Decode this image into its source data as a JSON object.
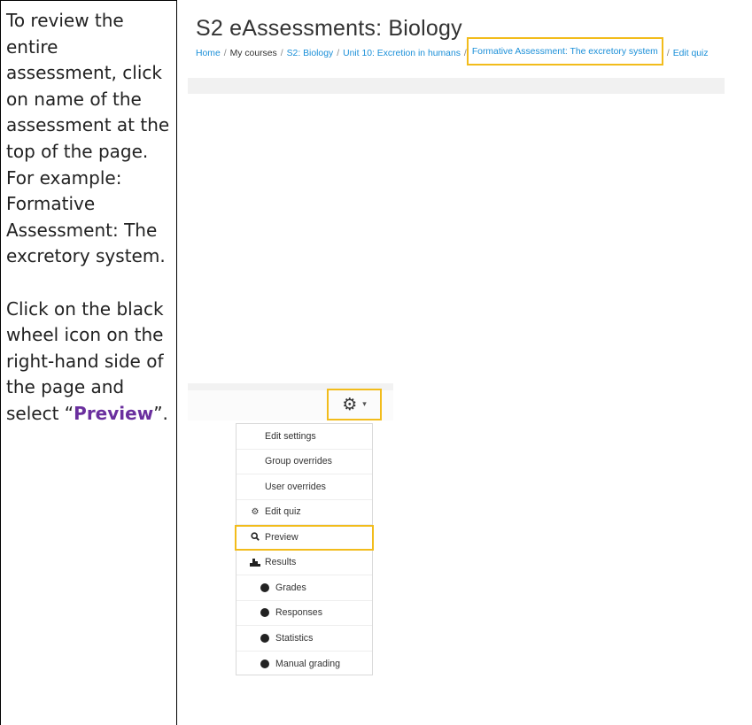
{
  "instructions": {
    "paragraph1": "To review the entire assessment, click on name of the assessment at the top of the page. For example: Formative Assessment: The excretory system.",
    "paragraph2_before": "Click on the black wheel icon on the right-hand side of the page and select “",
    "paragraph2_highlight": "Preview",
    "paragraph2_after": "”."
  },
  "screenshot1": {
    "page_title": "S2 eAssessments: Biology",
    "breadcrumb": [
      "Home",
      "My courses",
      "S2: Biology",
      "Unit 10: Excretion in humans",
      "Formative Assessment: The excretory system",
      "Edit quiz"
    ],
    "separator": "/"
  },
  "screenshot2": {
    "gear_icon": "⚙",
    "caret_icon": "▾",
    "menu_items": {
      "edit_settings": "Edit settings",
      "group_overrides": "Group overrides",
      "user_overrides": "User overrides",
      "edit_quiz": "Edit quiz",
      "preview": "Preview",
      "results": "Results",
      "grades": "Grades",
      "responses": "Responses",
      "statistics": "Statistics",
      "manual_grading": "Manual grading"
    }
  },
  "colors": {
    "highlight_border": "#f2bc1b",
    "link_blue": "#1a8fd8",
    "emphasis_purple": "#6a2f9e"
  }
}
